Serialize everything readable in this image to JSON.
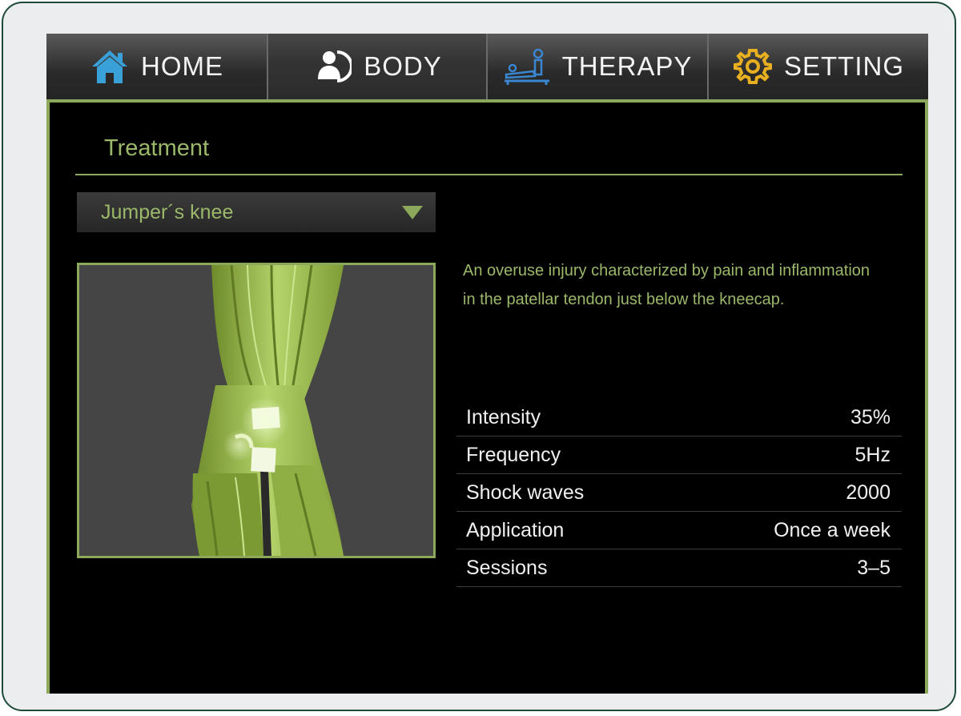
{
  "tabs": [
    {
      "id": "home",
      "label": "HOME",
      "icon": "house-icon",
      "icon_color": "#3aa0d8",
      "active": false
    },
    {
      "id": "body",
      "label": "BODY",
      "icon": "person-body-icon",
      "icon_color": "#ffffff",
      "active": true
    },
    {
      "id": "therapy",
      "label": "THERAPY",
      "icon": "therapy-bed-icon",
      "icon_color": "#3a86d0",
      "active": false
    },
    {
      "id": "setting",
      "label": "SETTING",
      "icon": "gear-icon",
      "icon_color": "#e8b020",
      "active": false
    }
  ],
  "treatment": {
    "title": "Treatment",
    "selected_condition": "Jumper´s knee",
    "image": "knee-muscle-anatomy-image",
    "description": "An overuse injury characterized by pain and inflammation in the patellar tendon just below the kneecap.",
    "params": [
      {
        "label": "Intensity",
        "value": "35%"
      },
      {
        "label": "Frequency",
        "value": "5Hz"
      },
      {
        "label": "Shock waves",
        "value": "2000"
      },
      {
        "label": "Application",
        "value": "Once a week"
      },
      {
        "label": "Sessions",
        "value": "3–5"
      }
    ]
  },
  "colors": {
    "accent": "#8ca85a",
    "accent_text": "#9bb86a",
    "frame_border": "#1e4a3a"
  }
}
